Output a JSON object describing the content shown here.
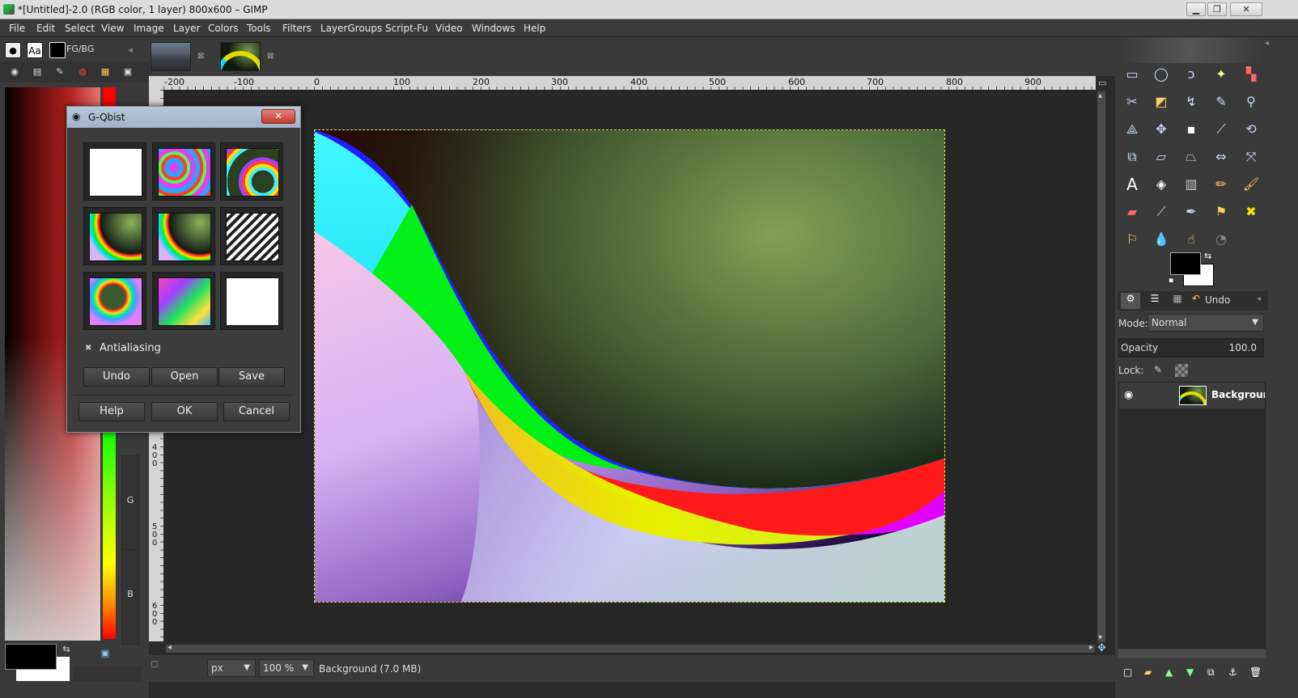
{
  "window": {
    "title": "*[Untitled]-2.0 (RGB color, 1 layer) 800x600 – GIMP",
    "controls": [
      "minimize",
      "restore",
      "close"
    ]
  },
  "menubar": [
    "File",
    "Edit",
    "Select",
    "View",
    "Image",
    "Layer",
    "Colors",
    "Tools",
    "Filters",
    "LayerGroups",
    "Script-Fu",
    "Video",
    "Windows",
    "Help"
  ],
  "left_dock": {
    "tab_fgbg_label": "FG/BG",
    "tab_text_label": "Aa",
    "channel_labels": {
      "g": "G",
      "b": "B"
    }
  },
  "rulers": {
    "horizontal": [
      "-200",
      "-100",
      "0",
      "100",
      "200",
      "300",
      "400",
      "500",
      "600",
      "700",
      "800",
      "900"
    ],
    "vertical": [
      "4\n0\n0",
      "5\n0\n0",
      "6\n0\n0"
    ]
  },
  "status": {
    "unit": "px",
    "zoom": "100 %",
    "info": "Background (7.0 MB)"
  },
  "dialog": {
    "title": "G-Qbist",
    "antialiasing_label": "Antialiasing",
    "antialiasing_checked": true,
    "row_buttons": {
      "undo": "Undo",
      "open": "Open",
      "save": "Save"
    },
    "footer_buttons": {
      "help": "Help",
      "ok": "OK",
      "cancel": "Cancel"
    }
  },
  "layers": {
    "mode_label": "Mode:",
    "mode_value": "Normal",
    "opacity_label": "Opacity",
    "opacity_value": "100.0",
    "lock_label": "Lock:",
    "undo_tab": "Undo",
    "items": [
      {
        "name": "Background",
        "visible": true
      }
    ]
  },
  "colors": {
    "accent": "#9fb2c8",
    "dialog_bg": "#3c3c3c",
    "dock_bg": "#3a3a3a"
  }
}
